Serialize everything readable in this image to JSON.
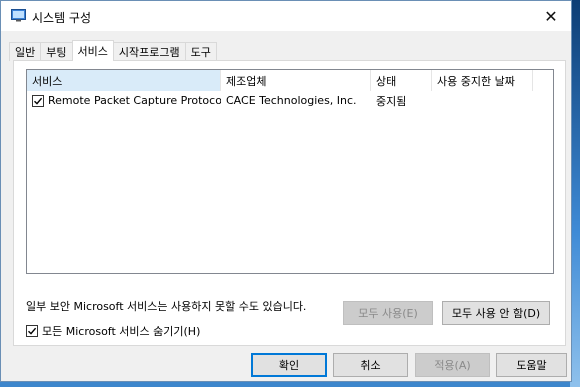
{
  "window": {
    "title": "시스템 구성",
    "close_glyph": "✕"
  },
  "tabs": [
    {
      "label": "일반",
      "active": false
    },
    {
      "label": "부팅",
      "active": false
    },
    {
      "label": "서비스",
      "active": true
    },
    {
      "label": "시작프로그램",
      "active": false
    },
    {
      "label": "도구",
      "active": false
    }
  ],
  "services": {
    "columns": [
      "서비스",
      "제조업체",
      "상태",
      "사용 중지한 날짜"
    ],
    "rows": [
      {
        "checked": true,
        "service": "Remote Packet Capture Protocol v....",
        "manufacturer": "CACE Technologies, Inc.",
        "status": "중지됨",
        "date_disabled": ""
      }
    ]
  },
  "note": "일부 보안 Microsoft 서비스는 사용하지 못할 수도 있습니다.",
  "buttons": {
    "enable_all": "모두 사용(E)",
    "disable_all": "모두 사용 안 함(D)",
    "ok": "확인",
    "cancel": "취소",
    "apply": "적용(A)",
    "help": "도움말"
  },
  "hide_ms": {
    "label": "모든 Microsoft 서비스 숨기기(H)",
    "checked": true
  },
  "colors": {
    "accent": "#0078d7",
    "header_sorted": "#d9ebf9"
  }
}
